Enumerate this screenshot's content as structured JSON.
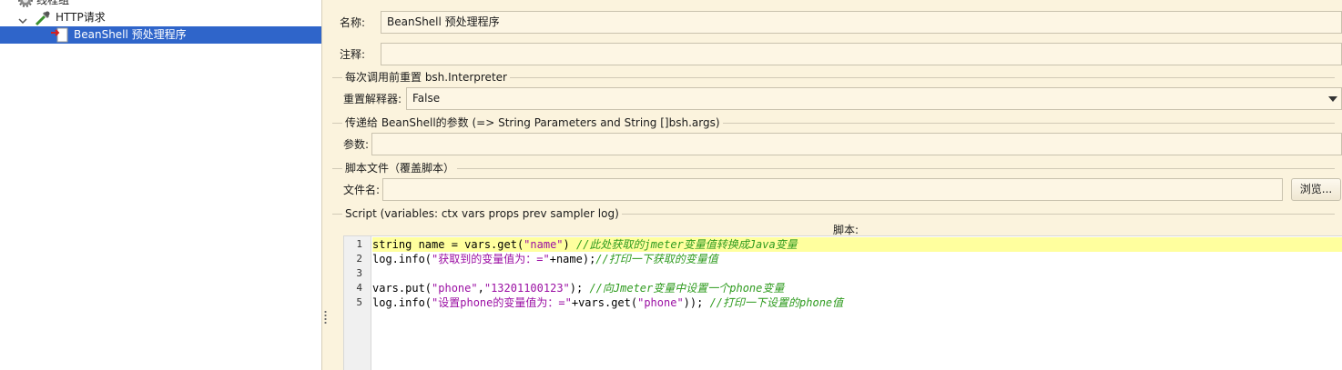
{
  "tree": {
    "thread_group": "线程组",
    "http_request": "HTTP请求",
    "beanshell": "BeanShell 预处理程序"
  },
  "form": {
    "name_label": "名称:",
    "name_value": "BeanShell 预处理程序",
    "comment_label": "注释:",
    "comment_value": "",
    "reset_section": "每次调用前重置 bsh.Interpreter",
    "reset_label": "重置解释器:",
    "reset_value": "False",
    "params_section": "传递给 BeanShell的参数 (=> String Parameters and String []bsh.args)",
    "params_label": "参数:",
    "params_value": "",
    "file_section": "脚本文件（覆盖脚本）",
    "filename_label": "文件名:",
    "filename_value": "",
    "browse_label": "浏览...",
    "script_section": "Script (variables: ctx vars props prev sampler log)",
    "script_caption": "脚本:"
  },
  "script": {
    "line_numbers": [
      "1",
      "2",
      "3",
      "4",
      "5"
    ],
    "lines": [
      [
        {
          "t": "string name = vars.get(",
          "c": "code"
        },
        {
          "t": "\"name\"",
          "c": "str"
        },
        {
          "t": ") ",
          "c": "code"
        },
        {
          "t": "//此处获取的jmeter变量值转换成Java变量",
          "c": "cmt"
        }
      ],
      [
        {
          "t": "log.info(",
          "c": "code"
        },
        {
          "t": "\"获取到的变量值为：=\"",
          "c": "str"
        },
        {
          "t": "+name);",
          "c": "code"
        },
        {
          "t": "//打印一下获取的变量值",
          "c": "cmt"
        }
      ],
      [],
      [
        {
          "t": "vars.put(",
          "c": "code"
        },
        {
          "t": "\"phone\"",
          "c": "str"
        },
        {
          "t": ",",
          "c": "code"
        },
        {
          "t": "\"13201100123\"",
          "c": "str"
        },
        {
          "t": "); ",
          "c": "code"
        },
        {
          "t": "//向Jmeter变量中设置一个phone变量",
          "c": "cmt"
        }
      ],
      [
        {
          "t": "log.info(",
          "c": "code"
        },
        {
          "t": "\"设置phone的变量值为：=\"",
          "c": "str"
        },
        {
          "t": "+vars.get(",
          "c": "code"
        },
        {
          "t": "\"phone\"",
          "c": "str"
        },
        {
          "t": ")); ",
          "c": "code"
        },
        {
          "t": "//打印一下设置的phone值",
          "c": "cmt"
        }
      ]
    ]
  },
  "colors": {
    "panel_bg": "#fbf3dd",
    "selection": "#2f65ca",
    "line_highlight": "#ffff9e",
    "string": "#9b0fa3",
    "comment": "#2f9b1f"
  },
  "icons": [
    "gear-icon",
    "chevron-down-icon",
    "pipette-icon",
    "beanshell-preprocessor-icon",
    "dropdown-arrow-icon",
    "splitter-grip-icon"
  ]
}
